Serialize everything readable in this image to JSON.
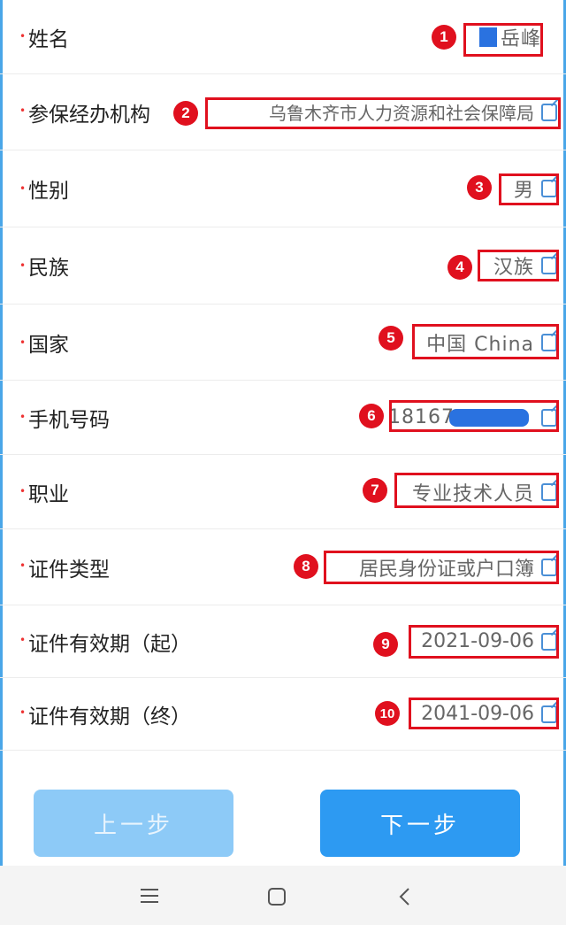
{
  "form": {
    "rows": [
      {
        "label": "姓名",
        "value": "岳峰"
      },
      {
        "label": "参保经办机构",
        "value": "乌鲁木齐市人力资源和社会保障局"
      },
      {
        "label": "性别",
        "value": "男"
      },
      {
        "label": "民族",
        "value": "汉族"
      },
      {
        "label": "国家",
        "value": "中国 China"
      },
      {
        "label": "手机号码",
        "value": "18167"
      },
      {
        "label": "职业",
        "value": "专业技术人员"
      },
      {
        "label": "证件类型",
        "value": "居民身份证或户口簿"
      },
      {
        "label": "证件有效期（起）",
        "value": "2021-09-06"
      },
      {
        "label": "证件有效期（终）",
        "value": "2041-09-06"
      }
    ],
    "required_mark": "•"
  },
  "badges": [
    "1",
    "2",
    "3",
    "4",
    "5",
    "6",
    "7",
    "8",
    "9",
    "10"
  ],
  "buttons": {
    "prev": "上一步",
    "next": "下一步"
  },
  "navbar": {
    "menu_icon": "menu-icon",
    "home_icon": "home-square-icon",
    "back_icon": "back-chevron-icon"
  },
  "colors": {
    "accent": "#2d9af2",
    "highlight": "#e0101e",
    "edit_icon": "#4a8fd6"
  }
}
